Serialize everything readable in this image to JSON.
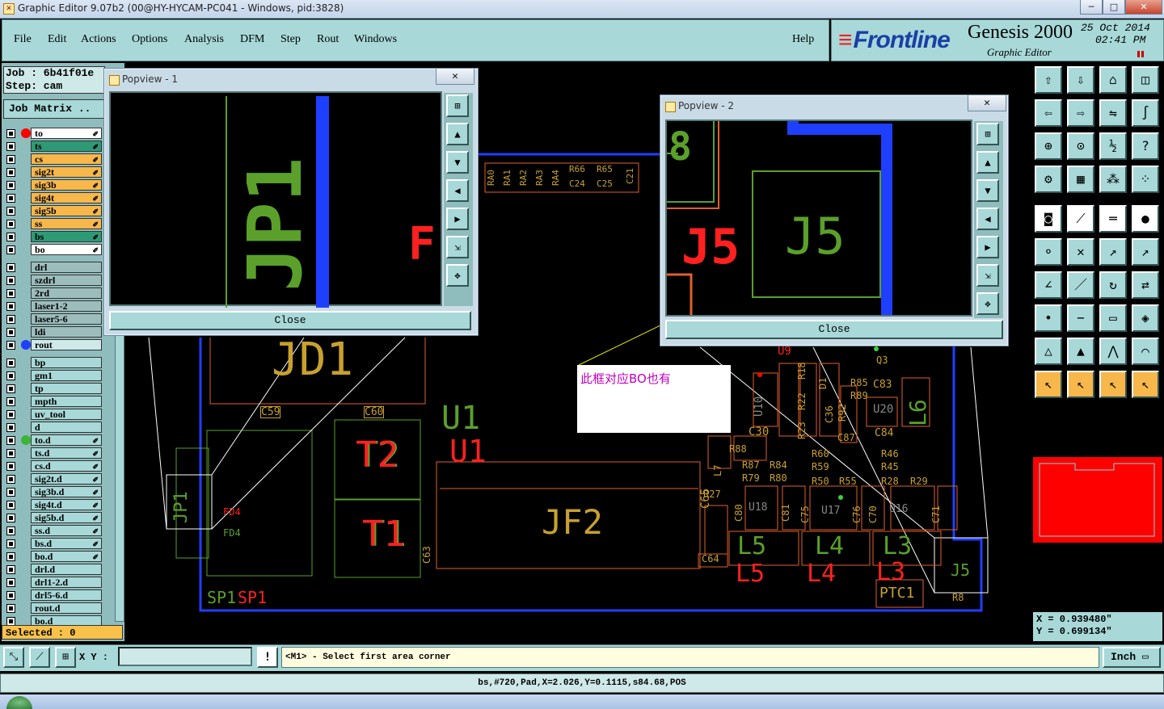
{
  "window": {
    "title": "Graphic Editor 9.07b2 (00@HY-HYCAM-PC041 - Windows, pid:3828)",
    "min": "─",
    "max": "□",
    "close": "✕"
  },
  "menu": {
    "items": [
      "File",
      "Edit",
      "Actions",
      "Options",
      "Analysis",
      "DFM",
      "Step",
      "Rout",
      "Windows"
    ],
    "help": "Help"
  },
  "brand": {
    "logo": "Frontline",
    "product": "Genesis 2000",
    "subtitle": "Graphic Editor",
    "date": "25 Oct 2014",
    "time": "02:41 PM"
  },
  "left_panel": {
    "job": "Job : 6b41f01e",
    "step": "Step: cam",
    "job_matrix": "Job Matrix ..",
    "board_layers": [
      {
        "name": "to",
        "color": "#ffffff"
      },
      {
        "name": "ts",
        "color": "#2e9a75"
      },
      {
        "name": "cs",
        "color": "#f7b74a"
      },
      {
        "name": "sig2t",
        "color": "#f7b74a"
      },
      {
        "name": "sig3b",
        "color": "#f7b74a"
      },
      {
        "name": "sig4t",
        "color": "#f7b74a"
      },
      {
        "name": "sig5b",
        "color": "#f7b74a"
      },
      {
        "name": "ss",
        "color": "#f7b74a"
      },
      {
        "name": "bs",
        "color": "#2e9a75"
      },
      {
        "name": "bo",
        "color": "#ffffff"
      }
    ],
    "drill_layers": [
      "drl",
      "szdrl",
      "2rd",
      "laser1-2",
      "laser5-6",
      "ldi",
      "rout"
    ],
    "misc_layers": [
      "bp",
      "gm1",
      "tp",
      "mpth",
      "uv_tool",
      "d",
      "to.d",
      "ts.d",
      "cs.d",
      "sig2t.d",
      "sig3b.d",
      "sig4t.d",
      "sig5b.d",
      "ss.d",
      "bs.d",
      "bo.d",
      "drl.d",
      "drl1-2.d",
      "drl5-6.d",
      "rout.d",
      "bo.d"
    ],
    "selected": "Selected : 0"
  },
  "popview1": {
    "title": "Popview - 1",
    "close_label": "Close"
  },
  "popview2": {
    "title": "Popview - 2",
    "close_label": "Close"
  },
  "annotation": "此框对应BO也有",
  "coords": {
    "x": "X = 0.939480\"",
    "y": "Y = 0.699134\""
  },
  "bottom": {
    "xy_label": "X Y :",
    "xy_value": "",
    "prompt": "<M1> - Select first area corner",
    "units": "Inch"
  },
  "status": "bs,#720,Pad,X=2.026,Y=0.1115,s84.68,POS",
  "pcb_labels": {
    "jd1": "JD1",
    "u1a": "U1",
    "u1b": "U1",
    "t2": "T2",
    "t1": "T1",
    "jf2": "JF2",
    "jp1": "JP1",
    "fd4a": "FD4",
    "fd4b": "FD4",
    "c59": "C59",
    "c60": "C60",
    "c63": "C63",
    "c64": "C64",
    "c65": "C65",
    "sp1a": "SP1",
    "sp1b": "SP1",
    "l5a": "L5",
    "l5b": "L5",
    "l4a": "L4",
    "l4b": "L4",
    "l3a": "L3",
    "l3b": "L3",
    "j5": "J5",
    "r8": "R8",
    "ptc1": "PTC1",
    "u18": "U18",
    "u17": "U17",
    "u16": "U16",
    "u20": "U20",
    "u10": "U10",
    "l6": "L6",
    "l7": "L7",
    "c30": "C30",
    "c36": "C36",
    "c84": "C84",
    "c83": "C83",
    "c87": "C87",
    "r88": "R88",
    "r87": "R87",
    "r84": "R84",
    "r79": "R79",
    "r80": "R80",
    "r27": "R27",
    "c80": "C80",
    "c81": "C81",
    "c75": "C75",
    "c76": "C76",
    "c70": "C70",
    "c71": "C71",
    "r60": "R60",
    "r59": "R59",
    "r50": "R50",
    "r55": "R55",
    "r46": "R46",
    "r45": "R45",
    "r28": "R28",
    "r29": "R29",
    "r85": "R85",
    "r89": "R89",
    "r92": "R92",
    "r18": "R18",
    "r22": "R22",
    "r23": "R23",
    "q3": "Q3",
    "u9": "U9",
    "d1": "D1",
    "ra0": "RA0",
    "ra1": "RA1",
    "ra2": "RA2",
    "ra3": "RA3",
    "ra4": "RA4",
    "r66": "R66",
    "r65": "R65",
    "c21": "C21",
    "c24": "C24",
    "c25": "C25",
    "pop1_jp1": "JP1",
    "pop1_f": "F(",
    "pop2_j5a": "J5",
    "pop2_j5b": "J5",
    "pop2_8": "8"
  }
}
